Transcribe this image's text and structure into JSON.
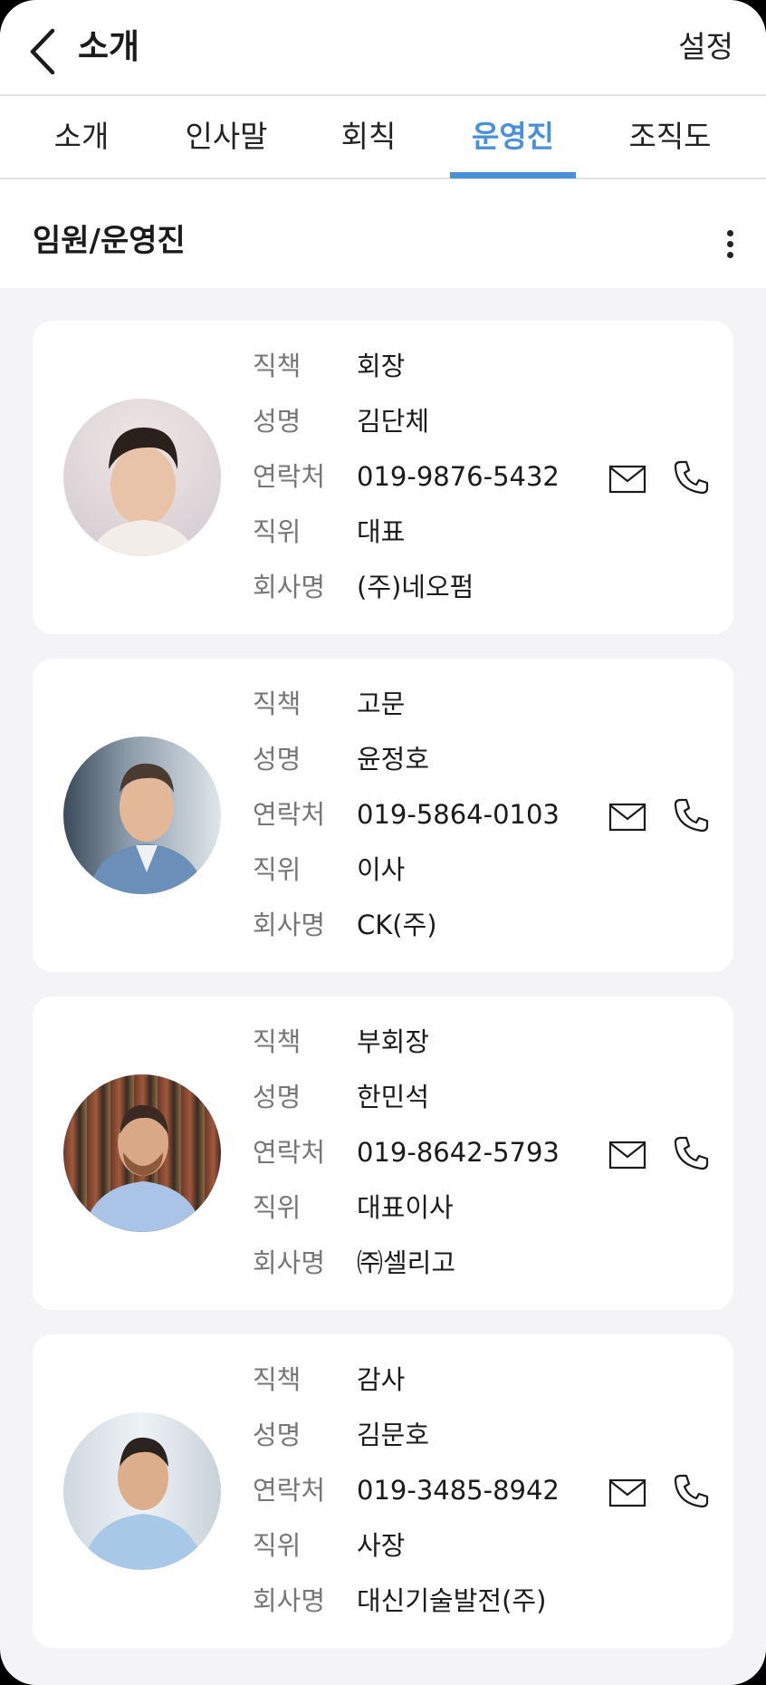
{
  "header": {
    "title": "소개",
    "settings_label": "설정"
  },
  "tabs": [
    {
      "label": "소개"
    },
    {
      "label": "인사말"
    },
    {
      "label": "회칙"
    },
    {
      "label": "운영진"
    },
    {
      "label": "조직도"
    }
  ],
  "active_tab": "운영진",
  "section": {
    "title": "임원/운영진"
  },
  "field_labels": {
    "position": "직책",
    "name": "성명",
    "contact": "연락처",
    "rank": "직위",
    "company": "회사명"
  },
  "members": [
    {
      "position": "회장",
      "name": "김단체",
      "contact": "019-9876-5432",
      "rank": "대표",
      "company": "(주)네오펌"
    },
    {
      "position": "고문",
      "name": "윤정호",
      "contact": "019-5864-0103",
      "rank": "이사",
      "company": "CK(주)"
    },
    {
      "position": "부회장",
      "name": "한민석",
      "contact": "019-8642-5793",
      "rank": "대표이사",
      "company": "㈜셀리고"
    },
    {
      "position": "감사",
      "name": "김문호",
      "contact": "019-3485-8942",
      "rank": "사장",
      "company": "대신기술발전(주)"
    }
  ],
  "colors": {
    "accent": "#4a90d9",
    "background": "#f4f4f6",
    "card": "#ffffff",
    "label": "#777777"
  },
  "icons": [
    "back-arrow-icon",
    "kebab-menu-icon",
    "mail-icon",
    "phone-icon"
  ]
}
